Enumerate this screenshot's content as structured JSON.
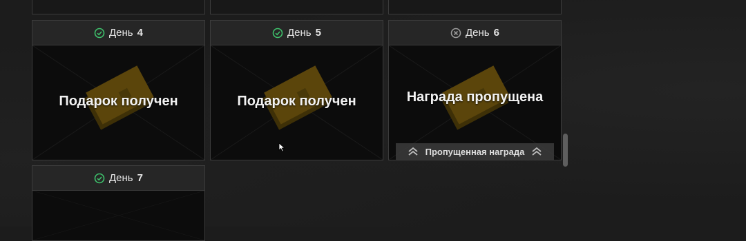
{
  "top_row": [
    {
      "id": "day-1"
    },
    {
      "id": "day-2"
    },
    {
      "id": "day-3"
    }
  ],
  "cards": [
    {
      "day_label": "День",
      "day_number": "4",
      "status": "claimed",
      "status_icon": "check-circle-icon",
      "message": "Подарок получен"
    },
    {
      "day_label": "День",
      "day_number": "5",
      "status": "claimed",
      "status_icon": "check-circle-icon",
      "message": "Подарок получен"
    },
    {
      "day_label": "День",
      "day_number": "6",
      "status": "missed",
      "status_icon": "x-circle-icon",
      "message": "Награда пропущена",
      "missed_label": "Пропущенная награда"
    },
    {
      "day_label": "День",
      "day_number": "7",
      "status": "claimed",
      "status_icon": "check-circle-icon",
      "message": ""
    }
  ],
  "colors": {
    "claimed": "#3ec06b",
    "missed": "#9a9a9a",
    "gift": "#d8a81a",
    "background": "#1c1c1c"
  }
}
